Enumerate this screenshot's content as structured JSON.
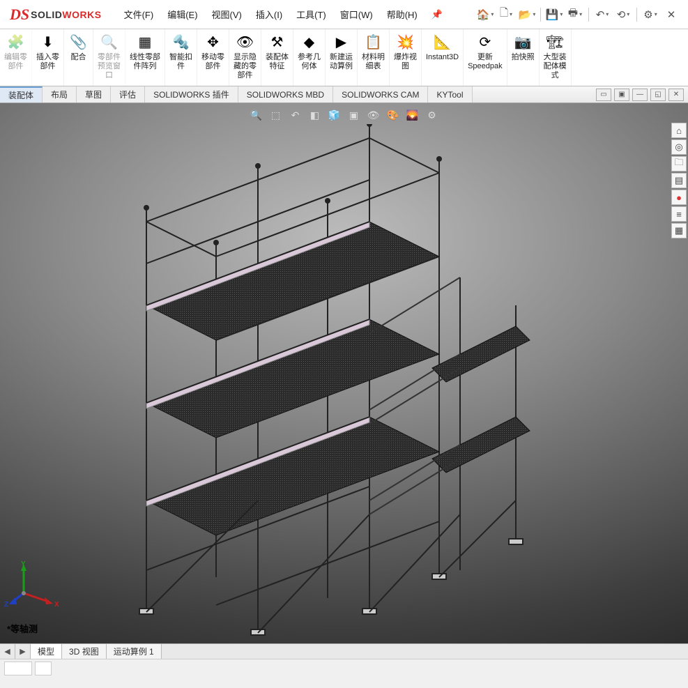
{
  "app": {
    "logo_solid": "SOLID",
    "logo_works": "WORKS"
  },
  "menus": [
    {
      "l": "文件(F)"
    },
    {
      "l": "编辑(E)"
    },
    {
      "l": "视图(V)"
    },
    {
      "l": "插入(I)"
    },
    {
      "l": "工具(T)"
    },
    {
      "l": "窗口(W)"
    },
    {
      "l": "帮助(H)"
    }
  ],
  "ribbon": [
    {
      "l": "编辑零\n部件",
      "dim": true
    },
    {
      "l": "插入零\n部件"
    },
    {
      "l": "配合"
    },
    {
      "l": "零部件\n预览窗\n口",
      "dim": true
    },
    {
      "l": "线性零部\n件阵列"
    },
    {
      "l": "智能扣\n件"
    },
    {
      "l": "移动零\n部件"
    },
    {
      "l": "显示隐\n藏的零\n部件"
    },
    {
      "l": "装配体\n特征"
    },
    {
      "l": "参考几\n何体"
    },
    {
      "l": "新建运\n动算例"
    },
    {
      "l": "材料明\n细表"
    },
    {
      "l": "爆炸视\n图"
    },
    {
      "l": "Instant3D"
    },
    {
      "l": "更新\nSpeedpak"
    },
    {
      "l": "拍快照"
    },
    {
      "l": "大型装\n配体模\n式"
    }
  ],
  "tabs": [
    {
      "l": "装配体",
      "active": true
    },
    {
      "l": "布局"
    },
    {
      "l": "草图"
    },
    {
      "l": "评估"
    },
    {
      "l": "SOLIDWORKS 插件"
    },
    {
      "l": "SOLIDWORKS MBD"
    },
    {
      "l": "SOLIDWORKS CAM"
    },
    {
      "l": "KYTool"
    }
  ],
  "triad": {
    "x": "X",
    "y": "Y",
    "z": "Z"
  },
  "view_name": "*等轴测",
  "bottom_tabs": [
    {
      "l": "模型",
      "active": true
    },
    {
      "l": "3D 视图"
    },
    {
      "l": "运动算例 1"
    }
  ]
}
